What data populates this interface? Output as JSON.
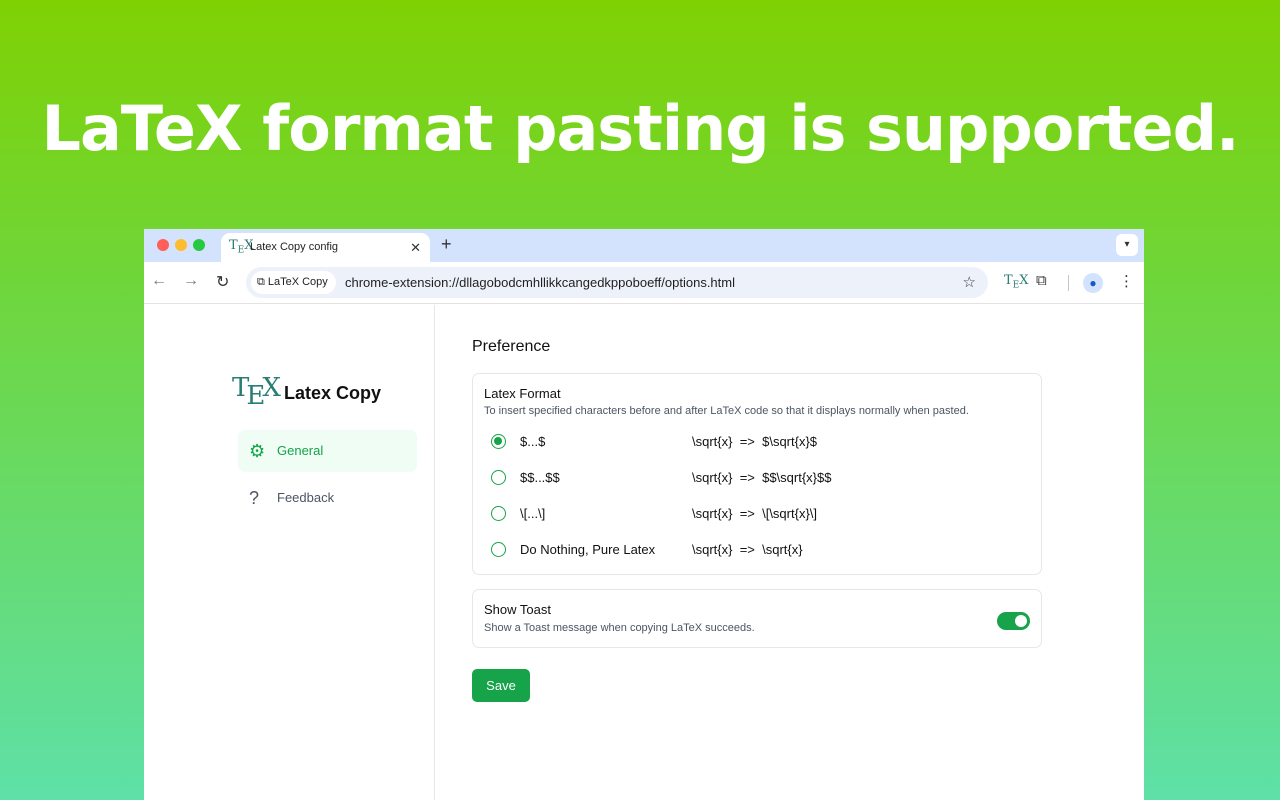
{
  "headline": "LaTeX format pasting is supported.",
  "browser": {
    "tab": {
      "icon": "tex-logo-icon",
      "title": "Latex Copy config",
      "close": "✕"
    },
    "new_tab": "+",
    "site_chip": "LaTeX Copy",
    "url": "chrome-extension://dllagobodcmhllikkcangedkppoboeff/options.html"
  },
  "sidebar": {
    "brand": {
      "logo": "TEX",
      "name": "Latex Copy"
    },
    "items": [
      {
        "label": "General",
        "icon": "gear-icon",
        "active": true
      },
      {
        "label": "Feedback",
        "icon": "question-bubble-icon",
        "active": false
      }
    ]
  },
  "main": {
    "section_title": "Preference",
    "latex_format": {
      "title": "Latex Format",
      "description": "To insert specified characters before and after LaTeX code so that it displays normally when pasted.",
      "options": [
        {
          "label": "$...$",
          "example": "\\sqrt{x}  =>  $\\sqrt{x}$",
          "selected": true
        },
        {
          "label": "$$...$$",
          "example": "\\sqrt{x}  =>  $$\\sqrt{x}$$",
          "selected": false
        },
        {
          "label": "\\[...\\]",
          "example": "\\sqrt{x}  =>  \\[\\sqrt{x}\\]",
          "selected": false
        },
        {
          "label": "Do Nothing, Pure Latex",
          "example": "\\sqrt{x}  =>  \\sqrt{x}",
          "selected": false
        }
      ]
    },
    "show_toast": {
      "title": "Show Toast",
      "description": "Show a Toast message when copying LaTeX succeeds.",
      "enabled": true
    },
    "save_label": "Save"
  },
  "colors": {
    "accent": "#16a34a",
    "active_bg": "#f0fdf4",
    "tab_strip": "#d3e3fd"
  }
}
